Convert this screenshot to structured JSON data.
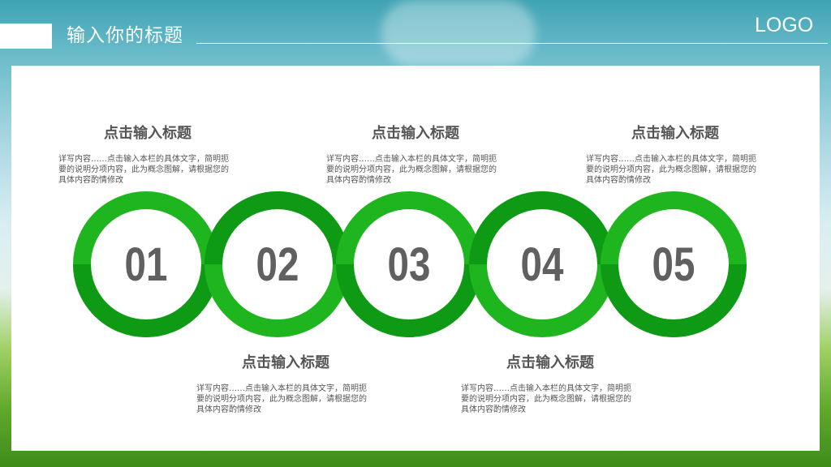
{
  "header": {
    "title": "输入你的标题",
    "logo": "LOGO"
  },
  "colors": {
    "ring_light": "#1fb51f",
    "ring_dark": "#0e9a14",
    "number_text": "#606060",
    "title_text": "#555555"
  },
  "steps": [
    {
      "number": "01",
      "title": "点击输入标题",
      "description": "详写内容……点击输入本栏的具体文字，简明扼要的说明分项内容，此为概念图解，请根据您的具体内容酌情修改"
    },
    {
      "number": "02",
      "title": "点击输入标题",
      "description": "详写内容……点击输入本栏的具体文字，简明扼要的说明分项内容，此为概念图解，请根据您的具体内容酌情修改"
    },
    {
      "number": "03",
      "title": "点击输入标题",
      "description": "详写内容……点击输入本栏的具体文字，简明扼要的说明分项内容，此为概念图解，请根据您的具体内容酌情修改"
    },
    {
      "number": "04",
      "title": "点击输入标题",
      "description": "详写内容……点击输入本栏的具体文字，简明扼要的说明分项内容，此为概念图解，请根据您的具体内容酌情修改"
    },
    {
      "number": "05",
      "title": "点击输入标题",
      "description": "详写内容……点击输入本栏的具体文字，简明扼要的说明分项内容，此为概念图解，请根据您的具体内容酌情修改"
    }
  ]
}
